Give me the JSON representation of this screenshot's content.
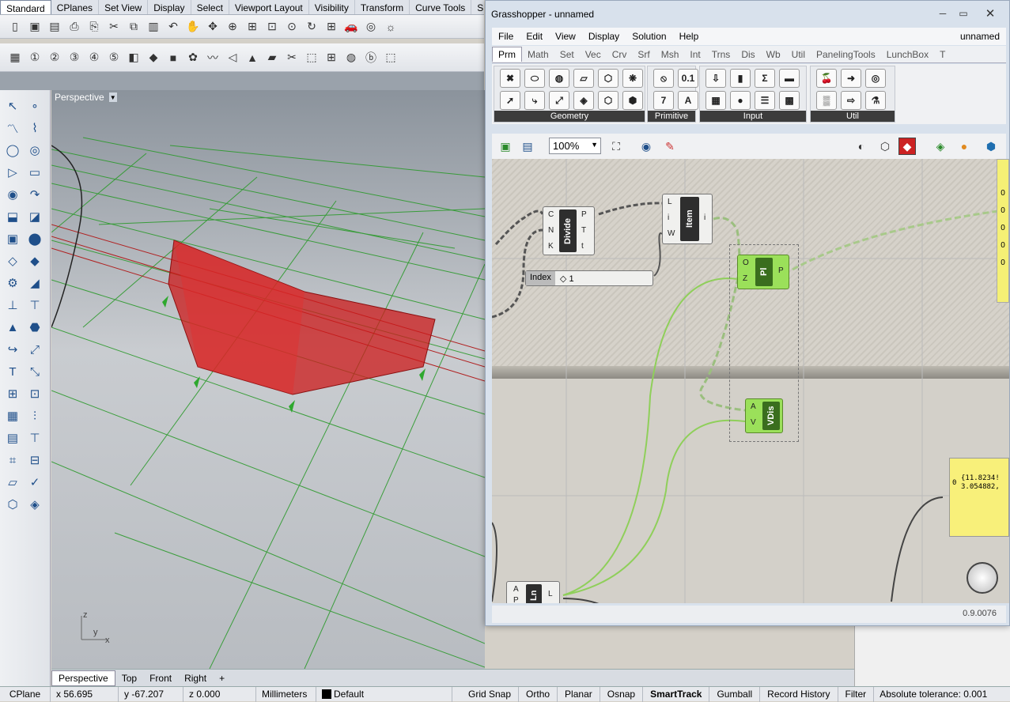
{
  "rhino": {
    "tabs": [
      "Standard",
      "CPlanes",
      "Set View",
      "Display",
      "Select",
      "Viewport Layout",
      "Visibility",
      "Transform",
      "Curve Tools",
      "Surfa"
    ],
    "viewport_title": "Perspective",
    "viewport_tabs": [
      "Perspective",
      "Top",
      "Front",
      "Right"
    ],
    "axis_labels": {
      "z": "z",
      "y": "y",
      "x": "x"
    },
    "status": {
      "cplane": "CPlane",
      "x": "x 56.695",
      "y": "y -67.207",
      "z": "z 0.000",
      "units": "Millimeters",
      "layer": "Default",
      "toggles": [
        "Grid Snap",
        "Ortho",
        "Planar",
        "Osnap",
        "SmartTrack",
        "Gumball",
        "Record History",
        "Filter"
      ],
      "tolerance": "Absolute tolerance: 0.001"
    },
    "toolbar_icon_names": [
      "new-icon",
      "open-icon",
      "save-icon",
      "print-icon",
      "import-icon",
      "cut-icon",
      "copy-icon",
      "paste-icon",
      "undo-icon",
      "pan-icon",
      "rotate-view-icon",
      "zoom-icon",
      "zoom-window-icon",
      "zoom-extents-icon",
      "zoom-selected-icon",
      "rotate-icon",
      "viewport-4-icon",
      "car-icon",
      "snap-icon",
      "light-icon"
    ]
  },
  "grasshopper": {
    "title": "Grasshopper - unnamed",
    "doc_name": "unnamed",
    "menu": [
      "File",
      "Edit",
      "View",
      "Display",
      "Solution",
      "Help"
    ],
    "tabs": [
      "Prm",
      "Math",
      "Set",
      "Vec",
      "Crv",
      "Srf",
      "Msh",
      "Int",
      "Trns",
      "Dis",
      "Wb",
      "Util",
      "PanelingTools",
      "LunchBox",
      "T"
    ],
    "groups": [
      "Geometry",
      "Primitive",
      "Input",
      "Util"
    ],
    "zoom": "100%",
    "version": "0.9.0076",
    "components": {
      "divide": {
        "name": "Divide",
        "inputs": [
          "C",
          "N",
          "K"
        ],
        "outputs": [
          "P",
          "T",
          "t"
        ]
      },
      "item": {
        "name": "Item",
        "inputs": [
          "L",
          "i",
          "W"
        ],
        "outputs": [
          "i"
        ]
      },
      "pl": {
        "name": "Pl",
        "inputs": [
          "O",
          "Z"
        ],
        "outputs": [
          "P"
        ]
      },
      "vdis": {
        "name": "VDis",
        "inputs": [
          "A",
          "V"
        ]
      },
      "len": {
        "name": "Ln",
        "inputs": [
          "A",
          "P"
        ],
        "outputs": [
          "L"
        ]
      }
    },
    "slider": {
      "label": "Index",
      "value": "◇ 1"
    },
    "panel": {
      "index": "0",
      "line1": "{11.8234!",
      "line2": "3.054882,"
    },
    "side_indices": [
      "0",
      "0",
      "0",
      "0",
      "0"
    ]
  }
}
